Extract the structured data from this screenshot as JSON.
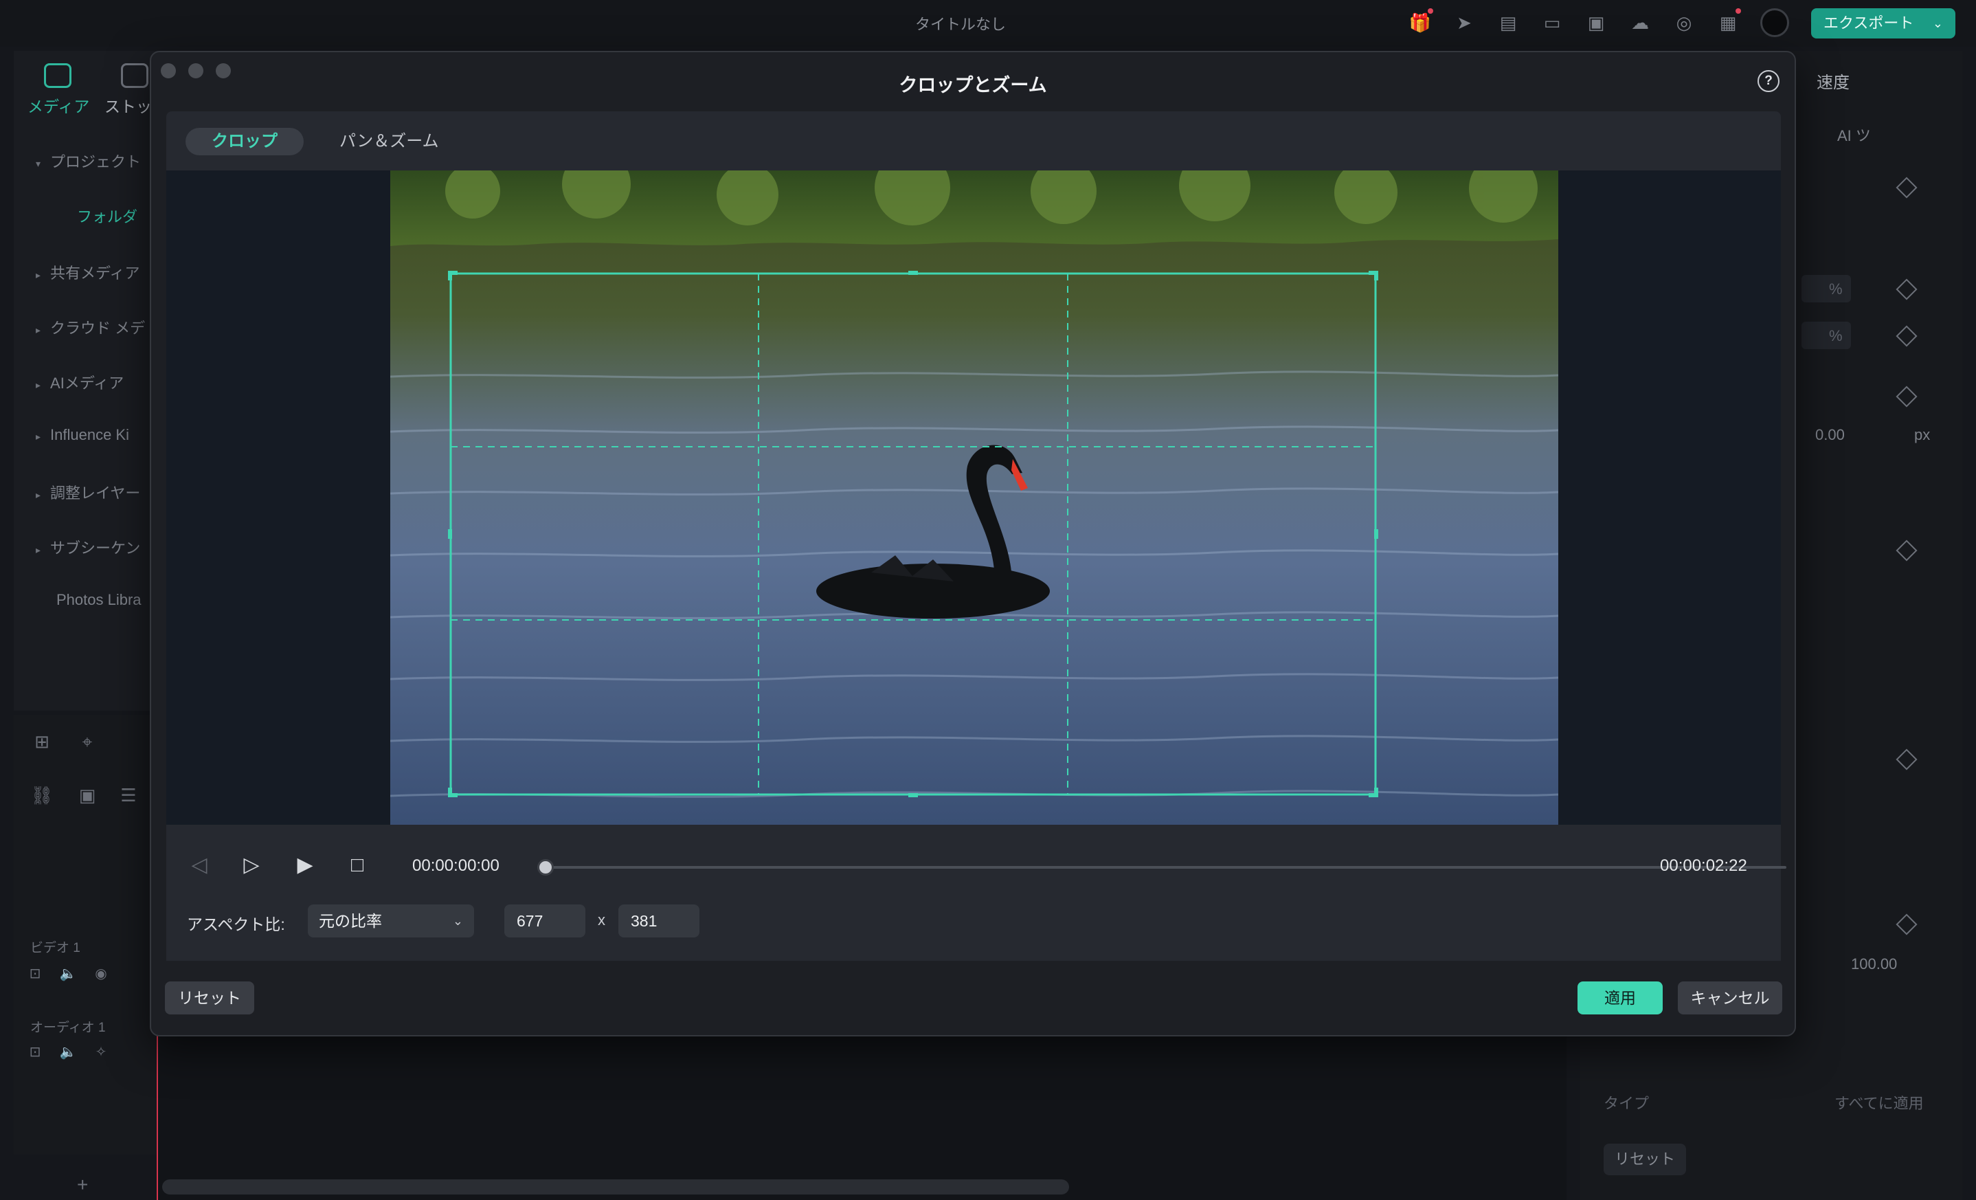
{
  "app": {
    "title": "タイトルなし",
    "export_label": "エクスポート",
    "accent_color": "#1b9c85"
  },
  "left_panel": {
    "tabs": [
      {
        "label": "メディア",
        "icon": "media-icon",
        "active": true
      },
      {
        "label": "ストッ",
        "icon": "store-icon",
        "active": false
      }
    ],
    "items": [
      {
        "label": "プロジェクト"
      },
      {
        "label": "フォルダ"
      },
      {
        "label": "共有メディア"
      },
      {
        "label": "クラウド メデ"
      },
      {
        "label": "AIメディア"
      },
      {
        "label": "Influence Ki"
      },
      {
        "label": "調整レイヤー"
      },
      {
        "label": "サブシーケン"
      },
      {
        "label": "Photos Libra"
      }
    ]
  },
  "tracks": {
    "video": "ビデオ 1",
    "audio": "オーディオ 1"
  },
  "right_panel": {
    "tab": "速度",
    "ai_tools": "AI ツ",
    "unit_percent": "%",
    "unit_px": "px",
    "value_px": "0.00",
    "value_opacity": "100.00",
    "type_label": "タイプ",
    "apply_all": "すべてに適用",
    "reset": "リセット"
  },
  "modal": {
    "title": "クロップとズーム",
    "help_icon": "help-circle-icon",
    "tabs": [
      {
        "label": "クロップ",
        "active": true
      },
      {
        "label": "パン＆ズーム",
        "active": false
      }
    ],
    "controls": {
      "current_time": "00:00:00:00",
      "total_time": "00:00:02:22",
      "progress": 0.0
    },
    "aspect": {
      "label": "アスペクト比:",
      "selected": "元の比率",
      "width": "677",
      "height": "381",
      "separator": "x"
    },
    "buttons": {
      "reset": "リセット",
      "apply": "適用",
      "cancel": "キャンセル"
    },
    "crop_color": "#3fd6b2",
    "apply_color": "#3fd6b2"
  }
}
